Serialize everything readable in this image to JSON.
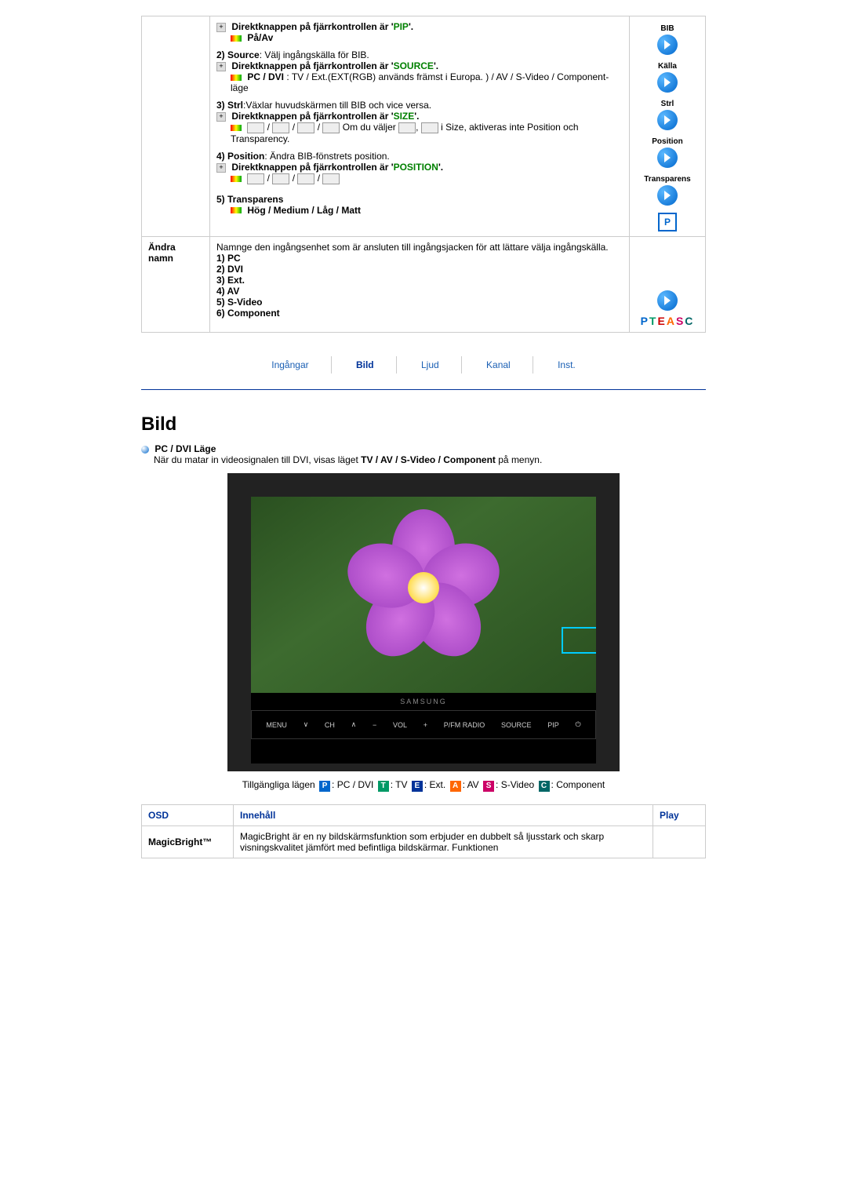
{
  "upper": {
    "pip_line_prefix": "Direktknappen på fjärrkontrollen är '",
    "pip_word": "PIP",
    "suffix": "'.",
    "on_off": "På/Av",
    "source_line_num": "2) Source",
    "source_line_text": ": Välj ingångskälla för BIB.",
    "source_btn_prefix": "Direktknappen på fjärrkontrollen är '",
    "source_word": "SOURCE",
    "pc_dvi_label": "PC / DVI",
    "pc_dvi_text": " : TV / Ext.(EXT(RGB) används främst i Europa. ) / AV / S-Video / Component-läge",
    "strl_num": "3) Strl",
    "strl_text": ":Växlar huvudskärmen till BIB och vice versa.",
    "size_prefix": "Direktknappen på fjärrkontrollen är '",
    "size_word": "SIZE",
    "size_note_mid": " Om du väljer ",
    "size_note_end": " i Size, aktiveras inte Position och Transparency.",
    "position_num": "4) Position",
    "position_text": ": Ändra BIB-fönstrets position.",
    "position_prefix": "Direktknappen på fjärrkontrollen är '",
    "position_word": "POSITION",
    "transparens_num": "5) Transparens",
    "transparens_opts": "Hög / Medium / Låg / Matt"
  },
  "right_col": {
    "bib": "BIB",
    "kalla": "Källa",
    "strl": "Strl",
    "position": "Position",
    "transparens": "Transparens",
    "p": "P"
  },
  "andra": {
    "label_l1": "Ändra",
    "label_l2": "namn",
    "desc": "Namnge den ingångsenhet som är ansluten till ingångsjacken för att lättare välja ingångskälla.",
    "items": [
      "1) PC",
      "2) DVI",
      "3) Ext.",
      "4) AV",
      "5) S-Video",
      "6) Component"
    ]
  },
  "tabs": {
    "ingangar": "Ingångar",
    "bild": "Bild",
    "ljud": "Ljud",
    "kanal": "Kanal",
    "inst": "Inst."
  },
  "section_title": "Bild",
  "pc_dvi_heading": "PC / DVI Läge",
  "pc_dvi_desc_pre": "När du matar in videosignalen till DVI, visas läget ",
  "pc_dvi_desc_bold": "TV / AV / S-Video / Component",
  "pc_dvi_desc_post": " på menyn.",
  "monitor": {
    "brand": "SAMSUNG",
    "menu": "MENU",
    "ch": "CH",
    "vol": "VOL",
    "radio": "P/FM RADIO",
    "source": "SOURCE",
    "pip": "PIP"
  },
  "legend": {
    "prefix": "Tillgängliga lägen",
    "pc": ": PC / DVI",
    "tv": ": TV",
    "ext": ": Ext.",
    "av": ": AV",
    "sv": ": S-Video",
    "comp": ": Component"
  },
  "osd": {
    "h1": "OSD",
    "h2": "Innehåll",
    "h3": "Play",
    "row1_label": "MagicBright™",
    "row1_text": "MagicBright är en ny bildskärmsfunktion som erbjuder en dubbelt så ljusstark och skarp visningskvalitet jämfört med befintliga bildskärmar. Funktionen"
  }
}
